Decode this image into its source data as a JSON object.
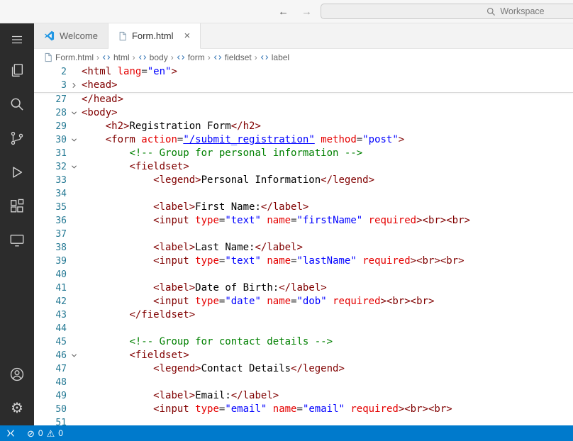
{
  "title_bar": {
    "back": "←",
    "forward": "→",
    "search_placeholder": "Workspace"
  },
  "activity_bar": {
    "items": [
      "menu-icon",
      "explorer-icon",
      "search-icon",
      "source-control-icon",
      "run-debug-icon",
      "extensions-icon",
      "remote-explorer-icon"
    ],
    "bottom_items": [
      "account-icon",
      "settings-gear-icon"
    ]
  },
  "tab_bar": {
    "tabs": [
      {
        "label": "Welcome",
        "icon": "vscode-logo-icon",
        "active": false
      },
      {
        "label": "Form.html",
        "icon": "html-file-icon",
        "active": true,
        "close": "×"
      }
    ]
  },
  "breadcrumb": {
    "separator": "›",
    "items": [
      "Form.html",
      "html",
      "body",
      "form",
      "fieldset",
      "label"
    ]
  },
  "editor": {
    "sticky": [
      {
        "num": 2,
        "indent": 0,
        "fold": null,
        "tokens": [
          [
            "t",
            "<html"
          ],
          [
            "a",
            " lang"
          ],
          [
            "e",
            "="
          ],
          [
            "v",
            "\"en\""
          ],
          [
            "t",
            ">"
          ]
        ]
      },
      {
        "num": 3,
        "indent": 0,
        "fold": "right",
        "tokens": [
          [
            "t",
            "<head>"
          ]
        ]
      }
    ],
    "lines": [
      {
        "num": 27,
        "indent": 0,
        "fold": null,
        "tokens": [
          [
            "t",
            "</head>"
          ]
        ]
      },
      {
        "num": 28,
        "indent": 0,
        "fold": "down",
        "tokens": [
          [
            "t",
            "<body>"
          ]
        ]
      },
      {
        "num": 29,
        "indent": 4,
        "fold": null,
        "tokens": [
          [
            "t",
            "<h2>"
          ],
          [
            "x",
            "Registration Form"
          ],
          [
            "t",
            "</h2>"
          ]
        ]
      },
      {
        "num": 30,
        "indent": 4,
        "fold": "down",
        "tokens": [
          [
            "t",
            "<form"
          ],
          [
            "a",
            " action"
          ],
          [
            "e",
            "="
          ],
          [
            "l",
            "\"/submit_registration\""
          ],
          [
            "a",
            " method"
          ],
          [
            "e",
            "="
          ],
          [
            "v",
            "\"post\""
          ],
          [
            "t",
            ">"
          ]
        ]
      },
      {
        "num": 31,
        "indent": 8,
        "fold": null,
        "tokens": [
          [
            "c",
            "<!-- Group for personal information -->"
          ]
        ]
      },
      {
        "num": 32,
        "indent": 8,
        "fold": "down",
        "tokens": [
          [
            "t",
            "<fieldset>"
          ]
        ]
      },
      {
        "num": 33,
        "indent": 12,
        "fold": null,
        "tokens": [
          [
            "t",
            "<legend>"
          ],
          [
            "x",
            "Personal Information"
          ],
          [
            "t",
            "</legend>"
          ]
        ]
      },
      {
        "num": 34,
        "indent": 0,
        "fold": null,
        "tokens": []
      },
      {
        "num": 35,
        "indent": 12,
        "fold": null,
        "tokens": [
          [
            "t",
            "<label>"
          ],
          [
            "x",
            "First Name:"
          ],
          [
            "t",
            "</label>"
          ]
        ]
      },
      {
        "num": 36,
        "indent": 12,
        "fold": null,
        "tokens": [
          [
            "t",
            "<input"
          ],
          [
            "a",
            " type"
          ],
          [
            "e",
            "="
          ],
          [
            "v",
            "\"text\""
          ],
          [
            "a",
            " name"
          ],
          [
            "e",
            "="
          ],
          [
            "v",
            "\"firstName\""
          ],
          [
            "a",
            " required"
          ],
          [
            "t",
            ">"
          ],
          [
            "t",
            "<br>"
          ],
          [
            "t",
            "<br>"
          ]
        ]
      },
      {
        "num": 37,
        "indent": 0,
        "fold": null,
        "tokens": []
      },
      {
        "num": 38,
        "indent": 12,
        "fold": null,
        "tokens": [
          [
            "t",
            "<label>"
          ],
          [
            "x",
            "Last Name:"
          ],
          [
            "t",
            "</label>"
          ]
        ]
      },
      {
        "num": 39,
        "indent": 12,
        "fold": null,
        "tokens": [
          [
            "t",
            "<input"
          ],
          [
            "a",
            " type"
          ],
          [
            "e",
            "="
          ],
          [
            "v",
            "\"text\""
          ],
          [
            "a",
            " name"
          ],
          [
            "e",
            "="
          ],
          [
            "v",
            "\"lastName\""
          ],
          [
            "a",
            " required"
          ],
          [
            "t",
            ">"
          ],
          [
            "t",
            "<br>"
          ],
          [
            "t",
            "<br>"
          ]
        ]
      },
      {
        "num": 40,
        "indent": 0,
        "fold": null,
        "tokens": []
      },
      {
        "num": 41,
        "indent": 12,
        "fold": null,
        "tokens": [
          [
            "t",
            "<label>"
          ],
          [
            "x",
            "Date of Birth:"
          ],
          [
            "t",
            "</label>"
          ]
        ]
      },
      {
        "num": 42,
        "indent": 12,
        "fold": null,
        "tokens": [
          [
            "t",
            "<input"
          ],
          [
            "a",
            " type"
          ],
          [
            "e",
            "="
          ],
          [
            "v",
            "\"date\""
          ],
          [
            "a",
            " name"
          ],
          [
            "e",
            "="
          ],
          [
            "v",
            "\"dob\""
          ],
          [
            "a",
            " required"
          ],
          [
            "t",
            ">"
          ],
          [
            "t",
            "<br>"
          ],
          [
            "t",
            "<br>"
          ]
        ]
      },
      {
        "num": 43,
        "indent": 8,
        "fold": null,
        "tokens": [
          [
            "t",
            "</fieldset>"
          ]
        ]
      },
      {
        "num": 44,
        "indent": 0,
        "fold": null,
        "tokens": []
      },
      {
        "num": 45,
        "indent": 8,
        "fold": null,
        "tokens": [
          [
            "c",
            "<!-- Group for contact details -->"
          ]
        ]
      },
      {
        "num": 46,
        "indent": 8,
        "fold": "down",
        "tokens": [
          [
            "t",
            "<fieldset>"
          ]
        ]
      },
      {
        "num": 47,
        "indent": 12,
        "fold": null,
        "tokens": [
          [
            "t",
            "<legend>"
          ],
          [
            "x",
            "Contact Details"
          ],
          [
            "t",
            "</legend>"
          ]
        ]
      },
      {
        "num": 48,
        "indent": 0,
        "fold": null,
        "tokens": []
      },
      {
        "num": 49,
        "indent": 12,
        "fold": null,
        "tokens": [
          [
            "t",
            "<label>"
          ],
          [
            "x",
            "Email:"
          ],
          [
            "t",
            "</label>"
          ]
        ]
      },
      {
        "num": 50,
        "indent": 12,
        "fold": null,
        "tokens": [
          [
            "t",
            "<input"
          ],
          [
            "a",
            " type"
          ],
          [
            "e",
            "="
          ],
          [
            "v",
            "\"email\""
          ],
          [
            "a",
            " name"
          ],
          [
            "e",
            "="
          ],
          [
            "v",
            "\"email\""
          ],
          [
            "a",
            " required"
          ],
          [
            "t",
            ">"
          ],
          [
            "t",
            "<br>"
          ],
          [
            "t",
            "<br>"
          ]
        ]
      },
      {
        "num": 51,
        "indent": 0,
        "fold": null,
        "tokens": []
      }
    ],
    "token_legend": {
      "t": "tag",
      "a": "attribute-name",
      "e": "punctuation",
      "v": "attribute-value",
      "l": "attribute-value-link",
      "x": "text",
      "c": "comment"
    }
  },
  "status_bar": {
    "error_icon": "⊘",
    "errors": "0",
    "warning_icon": "⚠",
    "warnings": "0"
  },
  "colors": {
    "status_bar_bg": "#007acc",
    "activity_bar_bg": "#2c2c2c",
    "tag": "#800000",
    "attribute_name": "#e50000",
    "attribute_value": "#0000ff",
    "comment": "#008000",
    "line_number": "#237893"
  }
}
